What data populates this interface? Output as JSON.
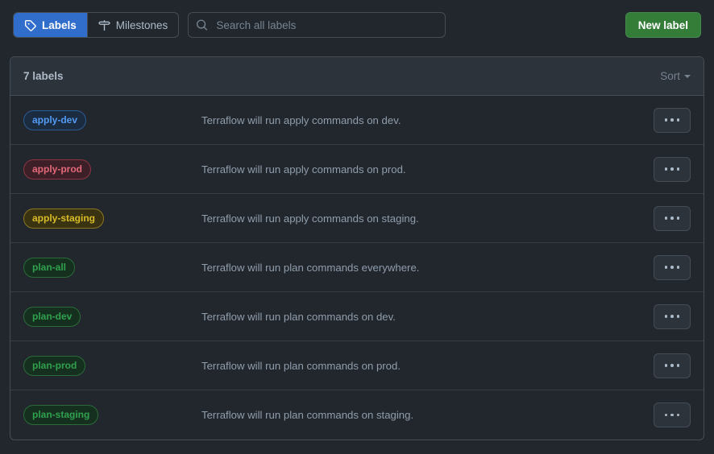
{
  "toolbar": {
    "tabs": [
      {
        "label": "Labels",
        "icon": "tag-icon",
        "active": true
      },
      {
        "label": "Milestones",
        "icon": "milestone-icon",
        "active": false
      }
    ],
    "search": {
      "placeholder": "Search all labels",
      "value": "",
      "icon": "search-icon"
    },
    "new_label_button": "New label"
  },
  "card": {
    "count_text": "7 labels",
    "sort_label": "Sort",
    "sort_icon": "chevron-down-icon",
    "row_action_icon": "kebab-menu-icon",
    "rows": [
      {
        "name": "apply-dev",
        "description": "Terraflow will run apply commands on dev.",
        "color_text": "#539bf5",
        "color_border": "#2b5b95",
        "color_bg": "#1b2b40"
      },
      {
        "name": "apply-prod",
        "description": "Terraflow will run apply commands on prod.",
        "color_text": "#e5687a",
        "color_border": "#8c3442",
        "color_bg": "#3d2027"
      },
      {
        "name": "apply-staging",
        "description": "Terraflow will run apply commands on staging.",
        "color_text": "#d9bd28",
        "color_border": "#8a7520",
        "color_bg": "#3a3312"
      },
      {
        "name": "plan-all",
        "description": "Terraflow will run plan commands everywhere.",
        "color_text": "#30a14e",
        "color_border": "#2a6b38",
        "color_bg": "#16301f"
      },
      {
        "name": "plan-dev",
        "description": "Terraflow will run plan commands on dev.",
        "color_text": "#30a14e",
        "color_border": "#2a6b38",
        "color_bg": "#16301f"
      },
      {
        "name": "plan-prod",
        "description": "Terraflow will run plan commands on prod.",
        "color_text": "#30a14e",
        "color_border": "#2a6b38",
        "color_bg": "#16301f"
      },
      {
        "name": "plan-staging",
        "description": "Terraflow will run plan commands on staging.",
        "color_text": "#30a14e",
        "color_border": "#2a6b38",
        "color_bg": "#16301f"
      }
    ]
  },
  "theme": {
    "page_bg": "#22272e",
    "card_bg": "#22272e",
    "card_header_bg": "#2d333b",
    "border": "#444c56",
    "accent_blue": "#316dca",
    "accent_green": "#347d39",
    "text_primary": "#adbac7",
    "text_muted": "#768390"
  }
}
